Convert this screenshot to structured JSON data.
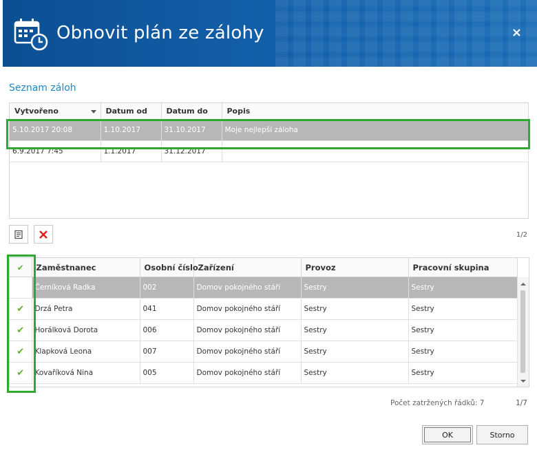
{
  "dialog": {
    "title": "Obnovit plán ze zálohy",
    "close_glyph": "×",
    "icon": "calendar-clock-icon"
  },
  "backups": {
    "section_title": "Seznam záloh",
    "columns": [
      "Vytvořeno",
      "Datum od",
      "Datum do",
      "Popis"
    ],
    "rows": [
      {
        "created": "5.10.2017 20:08",
        "from": "1.10.2017",
        "to": "31.10.2017",
        "desc": "Moje nejlepší záloha",
        "selected": true
      },
      {
        "created": "6.9.2017 7:45",
        "from": "1.1.2017",
        "to": "31.12.2017",
        "desc": "",
        "selected": false
      }
    ],
    "pager": "1/2"
  },
  "toolbar": {
    "edit_icon": "note-icon",
    "delete_icon": "delete-x-icon"
  },
  "employees": {
    "columns": [
      "",
      "Zaměstnanec",
      "Osobní číslo",
      "Zařízení",
      "Provoz",
      "Pracovní skupina"
    ],
    "check_glyph": "✔",
    "rows": [
      {
        "name": "Černíková Radka",
        "num": "002",
        "facility": "Domov pokojného stáří",
        "unit": "Sestry",
        "group": "Sestry",
        "selected": true
      },
      {
        "name": "Drzá Petra",
        "num": "041",
        "facility": "Domov pokojného stáří",
        "unit": "Sestry",
        "group": "Sestry",
        "selected": false
      },
      {
        "name": "Horálková Dorota",
        "num": "006",
        "facility": "Domov pokojného stáří",
        "unit": "Sestry",
        "group": "Sestry",
        "selected": false
      },
      {
        "name": "Klapková Leona",
        "num": "007",
        "facility": "Domov pokojného stáří",
        "unit": "Sestry",
        "group": "Sestry",
        "selected": false
      },
      {
        "name": "Kovaříková Nina",
        "num": "005",
        "facility": "Domov pokojného stáří",
        "unit": "Sestry",
        "group": "Sestry",
        "selected": false
      }
    ],
    "count_label": "Počet zatržených řádků: 7",
    "pager": "1/7"
  },
  "buttons": {
    "ok": "OK",
    "cancel": "Storno"
  },
  "colors": {
    "header_bg": "#0f5aa3",
    "accent": "#1c8ac9",
    "highlight": "#2eaa2e",
    "check": "#59b22a",
    "delete": "#e02020"
  }
}
